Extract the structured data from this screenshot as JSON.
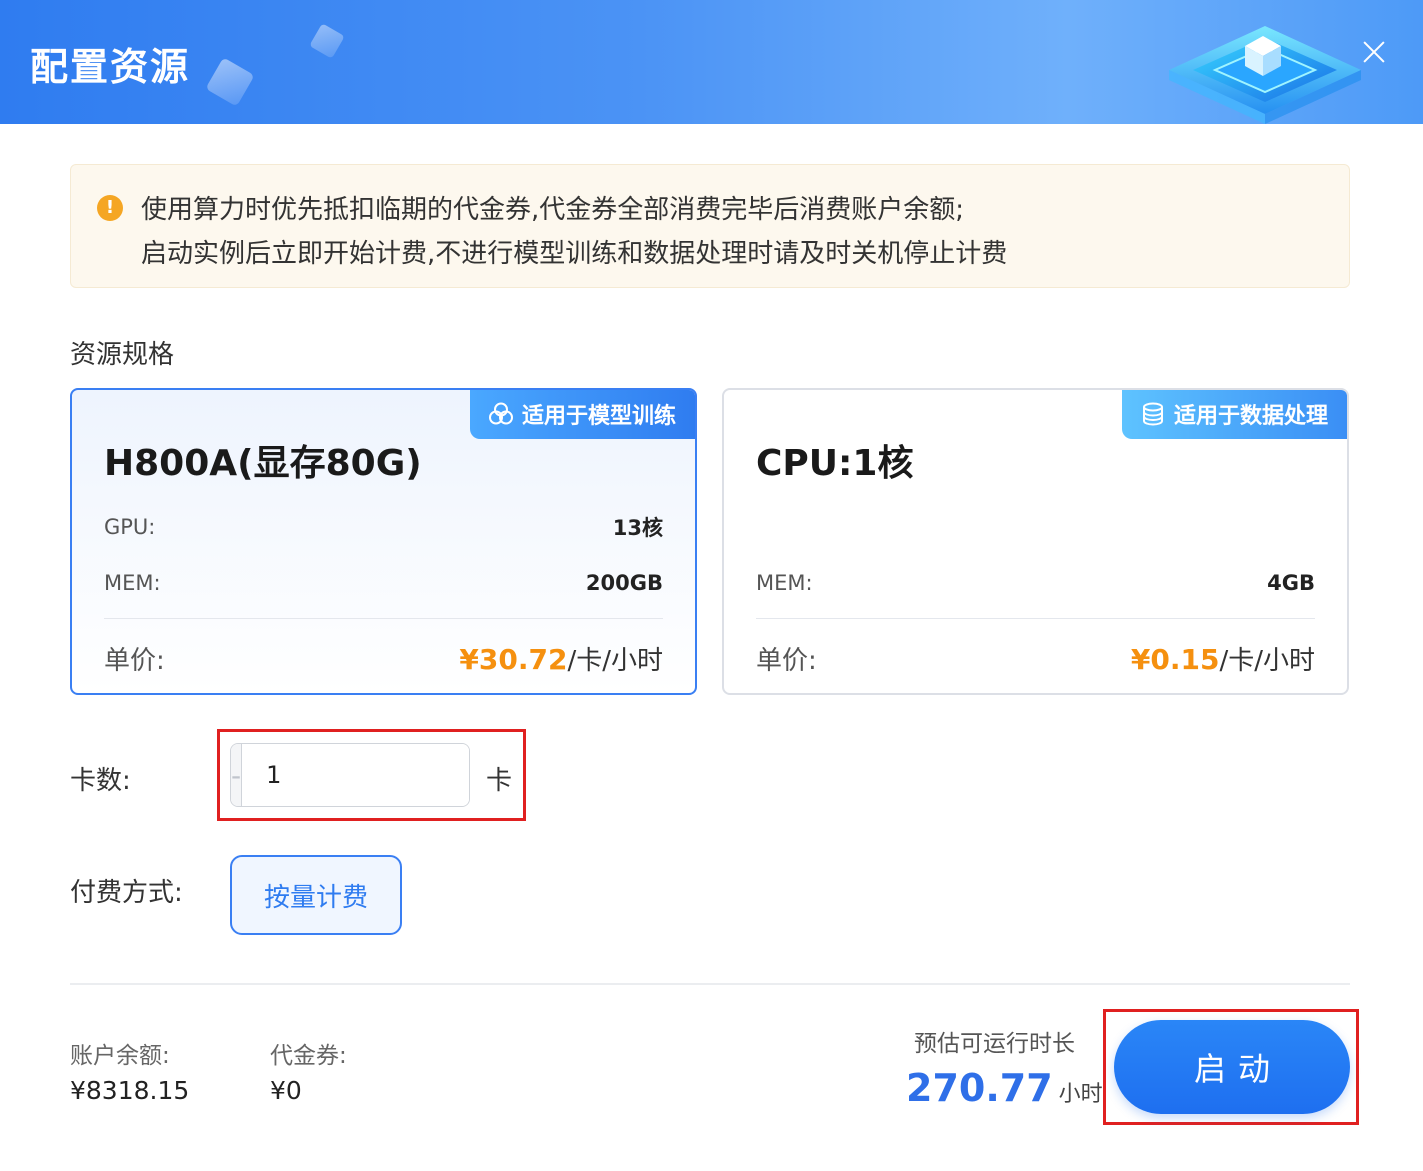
{
  "header": {
    "title": "配置资源"
  },
  "notice": {
    "icon": "!",
    "line1": "使用算力时优先抵扣临期的代金券,代金券全部消费完毕后消费账户余额;",
    "line2": "启动实例后立即开始计费,不进行模型训练和数据处理时请及时关机停止计费"
  },
  "resource": {
    "label": "资源规格",
    "cards": [
      {
        "tag": "适用于模型训练",
        "tag_icon": "model-training-icon",
        "title": "H800A(显存80G)",
        "specs": [
          {
            "key": "GPU:",
            "value": "13核"
          },
          {
            "key": "MEM:",
            "value": "200GB"
          }
        ],
        "price_key": "单价:",
        "price_currency": "¥",
        "price_amount": "30.72",
        "price_unit": "/卡/小时",
        "selected": true
      },
      {
        "tag": "适用于数据处理",
        "tag_icon": "database-icon",
        "title": "CPU:1核",
        "specs": [
          {
            "key": "MEM:",
            "value": "4GB"
          }
        ],
        "price_key": "单价:",
        "price_currency": "¥",
        "price_amount": "0.15",
        "price_unit": "/卡/小时",
        "selected": false
      }
    ]
  },
  "cards_count": {
    "label": "卡数:",
    "minus": "-",
    "value": "1",
    "plus": "+",
    "unit": "卡"
  },
  "billing": {
    "label": "付费方式:",
    "option": "按量计费"
  },
  "footer": {
    "balance_label": "账户余额:",
    "balance_value": "¥8318.15",
    "voucher_label": "代金券:",
    "voucher_value": "¥0",
    "estimate_label": "预估可运行时长",
    "estimate_value": "270.77",
    "estimate_unit": "小时",
    "start_button": "启动"
  },
  "colors": {
    "primary": "#2f7cf0",
    "price": "#f5900f",
    "warning": "#f5a623",
    "highlight": "#e02020"
  }
}
